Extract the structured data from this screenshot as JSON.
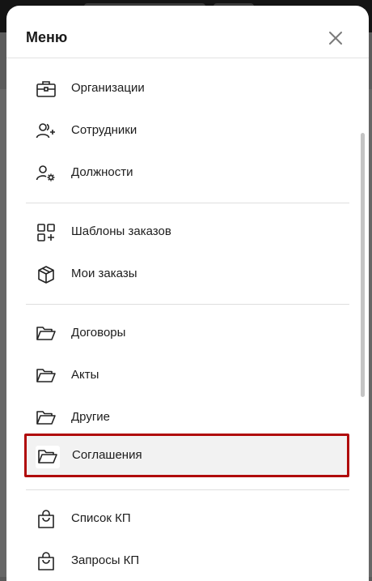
{
  "modal": {
    "title": "Меню"
  },
  "menu": {
    "groups": [
      {
        "items": [
          {
            "label": "Организации",
            "icon": "briefcase-icon"
          },
          {
            "label": "Сотрудники",
            "icon": "users-add-icon"
          },
          {
            "label": "Должности",
            "icon": "user-settings-icon"
          }
        ]
      },
      {
        "items": [
          {
            "label": "Шаблоны заказов",
            "icon": "grid-add-icon"
          },
          {
            "label": "Мои заказы",
            "icon": "box-icon"
          }
        ]
      },
      {
        "items": [
          {
            "label": "Договоры",
            "icon": "folder-icon"
          },
          {
            "label": "Акты",
            "icon": "folder-icon"
          },
          {
            "label": "Другие",
            "icon": "folder-icon"
          },
          {
            "label": "Соглашения",
            "icon": "folder-icon",
            "selected": true
          }
        ]
      },
      {
        "items": [
          {
            "label": "Список КП",
            "icon": "shopping-bag-icon"
          },
          {
            "label": "Запросы КП",
            "icon": "shopping-bag-icon"
          }
        ]
      }
    ]
  },
  "colors": {
    "selected_border": "#b00a0a",
    "selected_background": "#f2f2f2"
  }
}
